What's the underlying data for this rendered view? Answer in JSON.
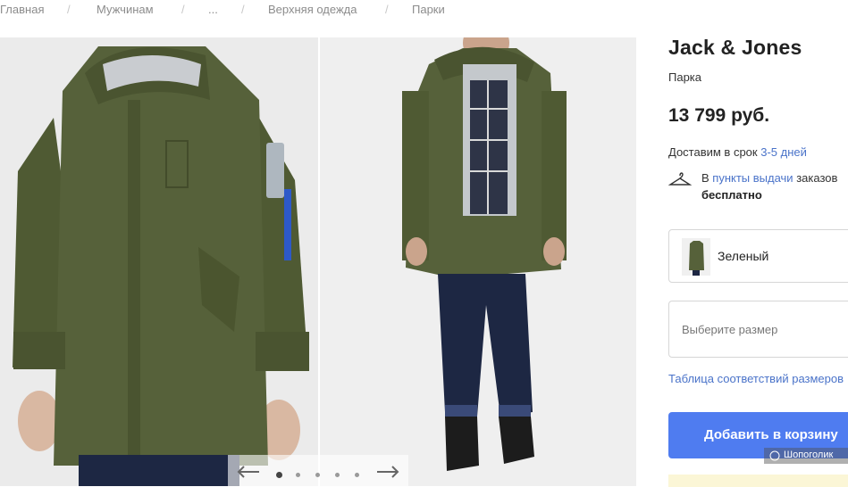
{
  "breadcrumb": {
    "items": [
      "Главная",
      "Мужчинам",
      "...",
      "Верхняя одежда",
      "Парки"
    ],
    "separator": "/"
  },
  "gallery": {
    "slide_count": 5,
    "active_slide": 1,
    "prev_icon": "arrow-left-icon",
    "next_icon": "arrow-right-icon"
  },
  "product": {
    "brand": "Jack & Jones",
    "type": "Парка",
    "price": "13 799 руб.",
    "delivery_prefix": "Доставим в срок ",
    "delivery_days": "3-5 дней",
    "pickup_prefix": "В ",
    "pickup_link": "пункты выдачи",
    "pickup_suffix": " заказов",
    "pickup_free": "бесплатно",
    "pickup_icon": "hanger-icon",
    "color_label": "Зеленый",
    "size_placeholder": "Выберите размер",
    "size_table_link": "Таблица соответствий размеров",
    "add_to_cart": "Добавить в корзину"
  },
  "colors": {
    "accent": "#4f7cf0",
    "link": "#4a73c9",
    "jacket": "#4f5a34"
  },
  "watermark": "Шопоголик"
}
